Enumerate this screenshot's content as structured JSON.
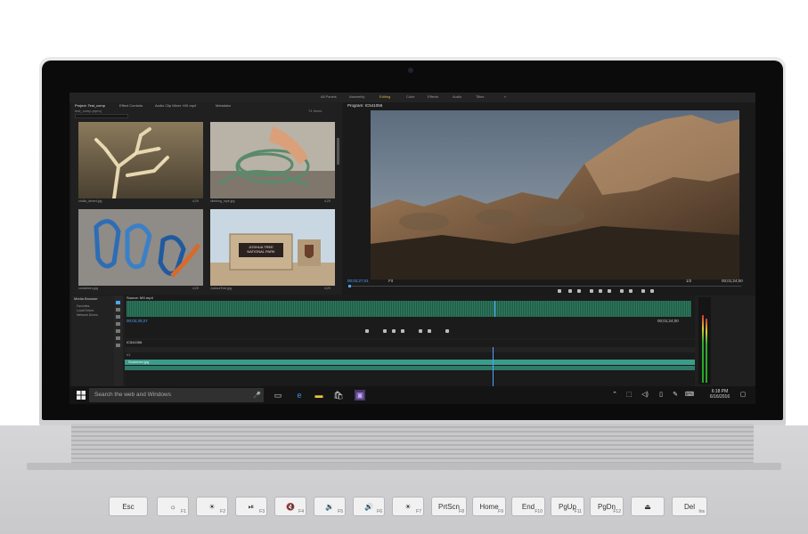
{
  "workspaces": [
    "All Panels",
    "Assembly",
    "Editing",
    "Color",
    "Effects",
    "Audio",
    "Titles"
  ],
  "active_workspace": "Editing",
  "project": {
    "tabs": [
      "Project: Test_comp",
      "Effect Controls",
      "Audio Clip Mixer: MX.mp4",
      "Metadata"
    ],
    "path": "test_comp.prproj",
    "count": "74 Items",
    "items": [
      {
        "name": "cholla_desert.jpg",
        "duration": "4;29"
      },
      {
        "name": "climbing_rope.jpg",
        "duration": "4;29"
      },
      {
        "name": "carabiners.jpg",
        "duration": "4;29"
      },
      {
        "name": "JoshuaTree.jpg",
        "duration": "4;29"
      }
    ],
    "sign_line1": "JOSHUA TREE",
    "sign_line2": "NATIONAL PARK"
  },
  "program": {
    "title": "Program: IC541056",
    "timecode_current": "00;02;27;01",
    "fit": "Fit",
    "quality": "1/2",
    "timecode_duration": "00;01;24;00"
  },
  "source": {
    "tab": "Source: MX.mp4",
    "timecode_current": "00;02;25;27",
    "timecode_duration": "00;01;24;00"
  },
  "media_browser": {
    "title": "Media Browser",
    "items": [
      "Favorites",
      "Local Drives",
      "Network Drives"
    ]
  },
  "timeline": {
    "sequence": "IC541056",
    "timecode": "00;02;27;01",
    "clip_label": "Scanmen.jpg",
    "tracks": [
      "V3",
      "V2",
      "V1",
      "A1",
      "A2",
      "A3"
    ]
  },
  "taskbar": {
    "search_placeholder": "Search the web and Windows",
    "time": "6:18 PM",
    "date": "6/16/2016"
  },
  "keyboard": {
    "keys": [
      {
        "label": "Esc",
        "fn": ""
      },
      {
        "label": "☼",
        "fn": "F1"
      },
      {
        "label": "☀",
        "fn": "F2"
      },
      {
        "label": "⏯",
        "fn": "F3"
      },
      {
        "label": "🔇",
        "fn": "F4"
      },
      {
        "label": "🔉",
        "fn": "F5"
      },
      {
        "label": "🔊",
        "fn": "F6"
      },
      {
        "label": "☀",
        "fn": "F7"
      },
      {
        "label": "PrtScn",
        "fn": "F8"
      },
      {
        "label": "Home",
        "fn": "F9"
      },
      {
        "label": "End",
        "fn": "F10"
      },
      {
        "label": "PgUp",
        "fn": "F11"
      },
      {
        "label": "PgDn",
        "fn": "F12"
      },
      {
        "label": "⏏",
        "fn": ""
      },
      {
        "label": "Del",
        "fn": "Ins"
      }
    ]
  },
  "colors": {
    "active_workspace": "#d8b34a",
    "timecode_blue": "#4fa3ff",
    "clip_teal": "#3b9c8a"
  }
}
